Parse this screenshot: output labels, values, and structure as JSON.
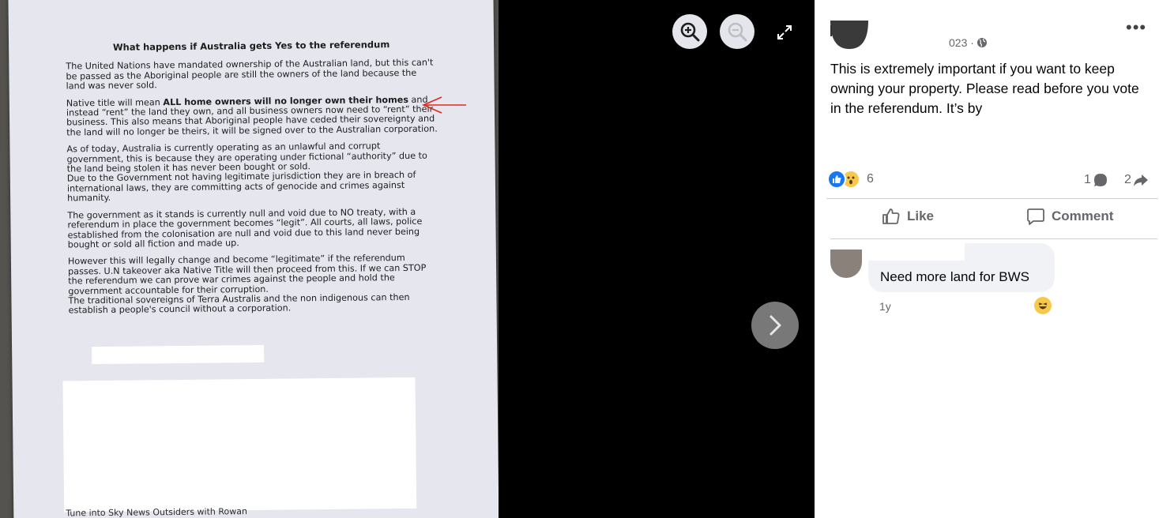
{
  "photo": {
    "title": "What happens if Australia gets Yes to the referendum",
    "paragraphs": [
      "The United Nations have mandated ownership of the Australian land, but this can't be passed as the Aboriginal people are still the owners of the land because the land was never sold.",
      "As of today, Australia is currently operating as an unlawful and corrupt government, this is because they are operating under fictional “authority” due to the land being stolen it has never been bought or sold.",
      "Due to the Government not having legitimate jurisdiction they are in breach of international laws, they are committing acts of genocide and crimes against humanity.",
      "The government as it stands is currently null and void due to NO treaty, with a referendum in place the government becomes “legit”. All courts, all laws, police established from the colonisation are null and void due to this land never being bought or sold all fiction and made up.",
      "However this will legally change and become “legitimate” if the referendum passes. U.N takeover aka Native Title will then proceed from this. If we can STOP the referendum we can prove war crimes against the people and hold the government accountable for their corruption.",
      "The traditional sovereigns of Terra Australis and the non indigenous can then establish a people's council without a corporation."
    ],
    "native_title": {
      "prefix": "Native title will mean ",
      "bold": "ALL home owners will no longer own their homes",
      "rest": " and instead “rent” the land they own, and all business owners now need to “rent” their business. This also means that Aboriginal people have ceded their sovereignty and the land will no longer be theirs, it will be signed over to the Australian corporation."
    },
    "footer_partial": "Tune into Sky News Outsiders with Rowan"
  },
  "viewer": {
    "zoom_in_icon": "zoom-in-icon",
    "zoom_out_icon": "zoom-out-icon",
    "fullscreen_icon": "expand-icon",
    "next_icon": "chevron-right-icon"
  },
  "post": {
    "date_partial": "023 ·",
    "text": "This is extremely important if you want to keep owning your property. Please read before you vote in the referendum. It’s by",
    "reaction_count": "6",
    "comment_count": "1",
    "share_count": "2",
    "like_label": "Like",
    "comment_label": "Comment"
  },
  "comment": {
    "text": "Need more land for BWS",
    "time": "1y"
  },
  "colors": {
    "accent": "#1877f2",
    "secondary_text": "#65676b",
    "bubble": "#f0f2f5",
    "arrow": "#e0281e"
  }
}
